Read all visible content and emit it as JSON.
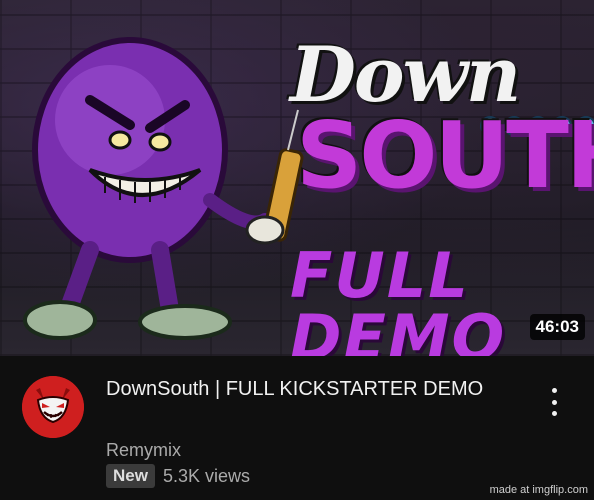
{
  "thumbnail": {
    "art_title_top": "Down",
    "art_title_bottom": "SOUTH",
    "art_subtitle": "FULL DEMO",
    "duration": "46:03"
  },
  "video": {
    "title": "DownSouth | FULL KICKSTARTER DEMO",
    "channel": "Remymix",
    "badge": "New",
    "views": "5.3K views"
  },
  "colors": {
    "background": "#0f0f0f",
    "accent_purple": "#b93be0",
    "avatar_red": "#cf1f1f"
  },
  "icons": {
    "more": "more-vert-icon"
  },
  "watermark": "made at imgflip.com"
}
